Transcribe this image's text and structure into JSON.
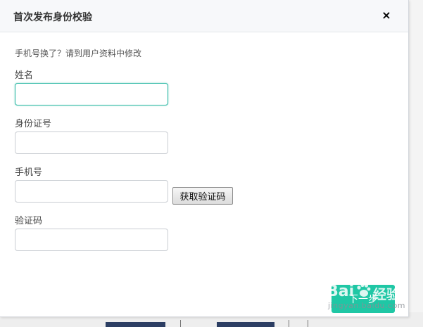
{
  "dialog": {
    "title": "首次发布身份校验",
    "close_glyph": "×",
    "hint": "手机号换了？请到用户资料中修改"
  },
  "form": {
    "name_label": "姓名",
    "name_value": "",
    "id_label": "身份证号",
    "id_value": "",
    "phone_label": "手机号",
    "phone_value": "",
    "sms_button_label": "获取验证码",
    "code_label": "验证码",
    "code_value": ""
  },
  "footer": {
    "submit_label": "下一步"
  },
  "watermark": {
    "brand": "Bai",
    "cn": "经验",
    "url": "jingyan.baidu.com"
  },
  "colors": {
    "accent": "#1fc7a5",
    "focus_border": "#2bb8a4",
    "header_bg": "#f7f8fa"
  }
}
